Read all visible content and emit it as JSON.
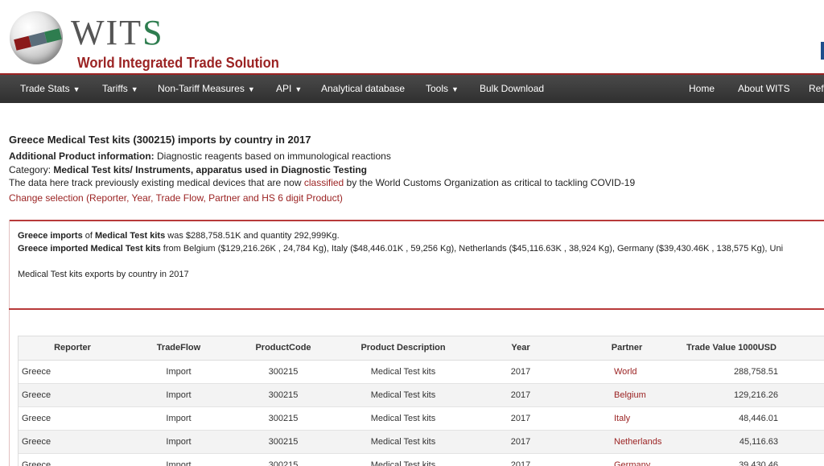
{
  "logo": {
    "brand": "WITS",
    "brand_w": "WIT",
    "brand_s": "S",
    "subtitle": "World Integrated Trade Solution"
  },
  "nav": {
    "items": [
      {
        "label": "Trade Stats",
        "caret": "▼"
      },
      {
        "label": "Tariffs",
        "caret": "▼"
      },
      {
        "label": "Non-Tariff Measures",
        "caret": "▼"
      },
      {
        "label": "API",
        "caret": "▼"
      },
      {
        "label": "Analytical database",
        "caret": ""
      },
      {
        "label": "Tools",
        "caret": "▼"
      },
      {
        "label": "Bulk Download",
        "caret": ""
      }
    ],
    "right": [
      {
        "label": "Home"
      },
      {
        "label": "About WITS"
      },
      {
        "label": "Ref"
      }
    ]
  },
  "content": {
    "title": "Greece Medical Test kits (300215) imports by country in 2017",
    "info_label": "Additional Product information:",
    "info_value": " Diagnostic reagents based on immunological reactions",
    "category_label": "Category: ",
    "category_value": "Medical Test kits/ Instruments, apparatus used in Diagnostic Testing",
    "track_pre": "The data here track previously existing medical devices that are now ",
    "track_link": "classified",
    "track_post": " by the World Customs Organization as critical to tackling COVID-19",
    "change_link": "Change selection (Reporter, Year, Trade Flow, Partner and HS 6 digit Product)"
  },
  "summary": {
    "l1_b1": "Greece imports",
    "l1_t1": " of ",
    "l1_b2": "Medical Test kits",
    "l1_t2": " was $288,758.51K and quantity 292,999Kg.",
    "l2_b1": "Greece imported Medical Test kits",
    "l2_t1": " from Belgium ($129,216.26K , 24,784 Kg), Italy ($48,446.01K , 59,256 Kg), Netherlands ($45,116.63K , 38,924 Kg), Germany ($39,430.46K , 138,575 Kg), Uni",
    "exports_link": "Medical Test kits exports by country in 2017"
  },
  "table": {
    "headers": [
      "Reporter",
      "TradeFlow",
      "ProductCode",
      "Product Description",
      "Year",
      "Partner",
      "Trade Value 1000USD",
      ""
    ],
    "rows": [
      [
        "Greece",
        "Import",
        "300215",
        "Medical Test kits",
        "2017",
        "World",
        "288,758.51",
        ""
      ],
      [
        "Greece",
        "Import",
        "300215",
        "Medical Test kits",
        "2017",
        "Belgium",
        "129,216.26",
        ""
      ],
      [
        "Greece",
        "Import",
        "300215",
        "Medical Test kits",
        "2017",
        "Italy",
        "48,446.01",
        ""
      ],
      [
        "Greece",
        "Import",
        "300215",
        "Medical Test kits",
        "2017",
        "Netherlands",
        "45,116.63",
        ""
      ],
      [
        "Greece",
        "Import",
        "300215",
        "Medical Test kits",
        "2017",
        "Germany",
        "39,430.46",
        ""
      ]
    ]
  },
  "colors": {
    "accent": "#9b2323",
    "nav_bg": "#3a3a3a",
    "logo_green": "#2e7d4f"
  }
}
